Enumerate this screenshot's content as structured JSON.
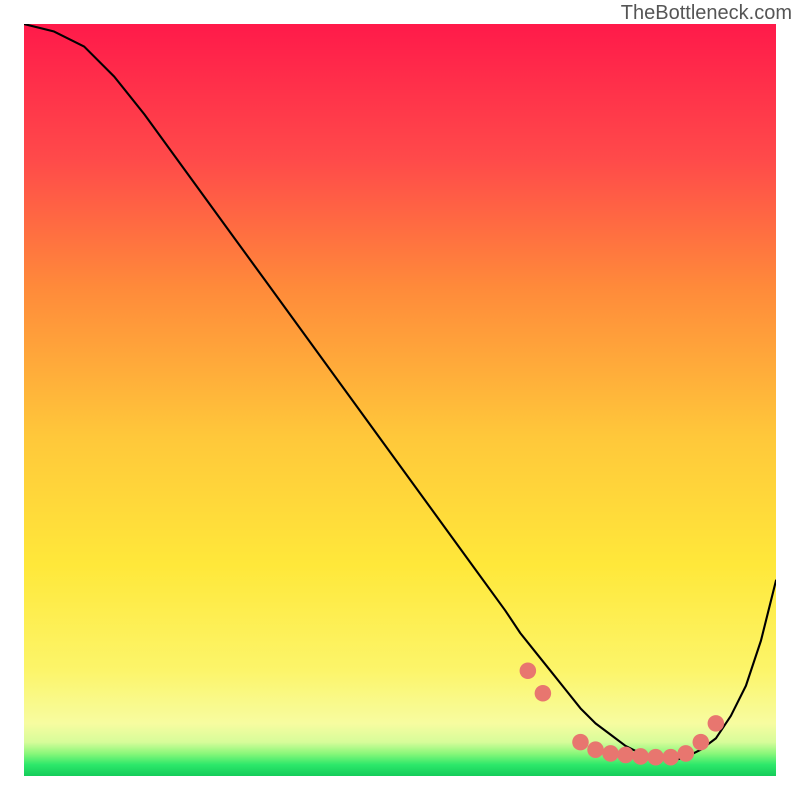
{
  "watermark": "TheBottleneck.com",
  "chart_data": {
    "type": "line",
    "title": "",
    "xlabel": "",
    "ylabel": "",
    "xlim": [
      0,
      100
    ],
    "ylim": [
      0,
      100
    ],
    "series": [
      {
        "name": "curve",
        "x": [
          0,
          4,
          8,
          12,
          16,
          20,
          24,
          28,
          32,
          36,
          40,
          44,
          48,
          52,
          56,
          60,
          64,
          66,
          68,
          70,
          72,
          74,
          76,
          78,
          80,
          82,
          84,
          86,
          88,
          90,
          92,
          94,
          96,
          98,
          100
        ],
        "values": [
          100,
          99,
          97,
          93,
          88,
          82.5,
          77,
          71.5,
          66,
          60.5,
          55,
          49.5,
          44,
          38.5,
          33,
          27.5,
          22,
          19,
          16.5,
          14,
          11.5,
          9,
          7,
          5.5,
          4,
          3,
          2.5,
          2,
          2.5,
          3.5,
          5,
          8,
          12,
          18,
          26
        ]
      }
    ],
    "markers": {
      "name": "highlight-dots",
      "x": [
        67,
        69,
        74,
        76,
        78,
        80,
        82,
        84,
        86,
        88,
        90,
        92
      ],
      "values": [
        14,
        11,
        4.5,
        3.5,
        3,
        2.8,
        2.6,
        2.5,
        2.5,
        3,
        4.5,
        7
      ],
      "color": "#e8766f"
    },
    "background_gradient": {
      "top": "#ff1a4a",
      "mid1": "#ff7a4a",
      "mid2": "#ffd23f",
      "mid3": "#fff07a",
      "bottom_band": "#1fe06a",
      "edge": "#14c95b"
    }
  }
}
